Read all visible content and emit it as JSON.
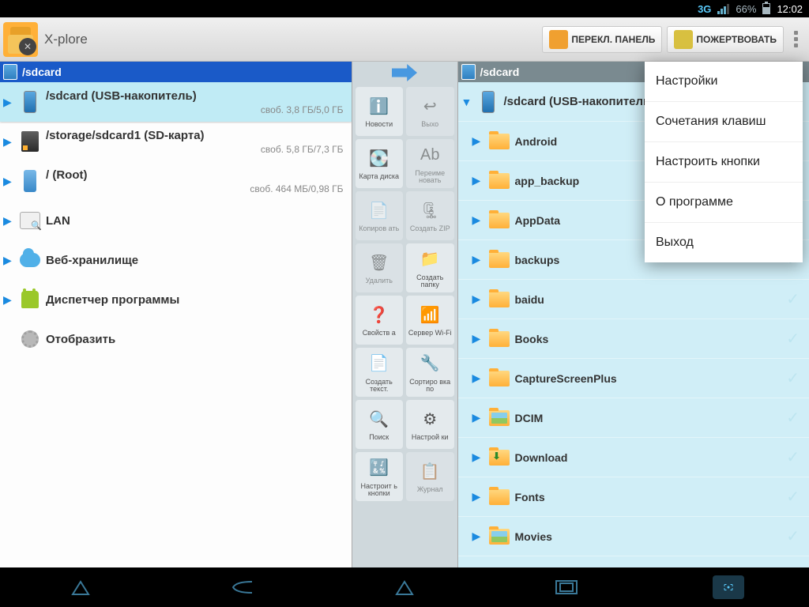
{
  "statusbar": {
    "net": "3G",
    "battery": "66%",
    "time": "12:02"
  },
  "toolbar": {
    "title": "X-plore",
    "switch_panel": "ПЕРЕКЛ. ПАНЕЛЬ",
    "donate": "ПОЖЕРТВОВАТЬ"
  },
  "left": {
    "head": "/sdcard",
    "items": [
      {
        "name": "/sdcard (USB-накопитель)",
        "sub": "своб. 3,8 ГБ/5,0 ГБ",
        "icon": "phone",
        "sel": true,
        "arrow": "▶"
      },
      {
        "name": "/storage/sdcard1 (SD-карта)",
        "sub": "своб. 5,8 ГБ/7,3 ГБ",
        "icon": "sdc",
        "arrow": "▶"
      },
      {
        "name": "/ (Root)",
        "sub": "своб. 464 МБ/0,98 ГБ",
        "icon": "root",
        "arrow": "▶"
      },
      {
        "name": "LAN",
        "icon": "lan",
        "arrow": "▶"
      },
      {
        "name": "Веб-хранилище",
        "icon": "cloud",
        "arrow": "▶"
      },
      {
        "name": "Диспетчер программы",
        "icon": "android",
        "arrow": "▶"
      },
      {
        "name": "Отобразить",
        "icon": "gear",
        "arrow": ""
      }
    ]
  },
  "right": {
    "head": "/sdcard",
    "parent": {
      "name": "/sdcard (USB-накопитель)",
      "icon": "phone",
      "arrow": "▼"
    },
    "folders": [
      {
        "name": "Android"
      },
      {
        "name": "app_backup"
      },
      {
        "name": "AppData"
      },
      {
        "name": "backups"
      },
      {
        "name": "baidu"
      },
      {
        "name": "Books"
      },
      {
        "name": "CaptureScreenPlus"
      },
      {
        "name": "DCIM",
        "pic": true
      },
      {
        "name": "Download",
        "dl": true
      },
      {
        "name": "Fonts"
      },
      {
        "name": "Movies",
        "pic": true
      }
    ]
  },
  "ops": [
    {
      "label": "Новости",
      "emoji": "ℹ️",
      "faded": false
    },
    {
      "label": "Выхо",
      "emoji": "↩",
      "faded": true
    },
    {
      "label": "Карта диска",
      "emoji": "💽",
      "faded": false
    },
    {
      "label": "Переиме новать",
      "emoji": "Ab",
      "faded": true
    },
    {
      "label": "Копиров ать",
      "emoji": "📄",
      "faded": true
    },
    {
      "label": "Создать ZIP",
      "emoji": "🗜",
      "faded": true
    },
    {
      "label": "Удалить",
      "emoji": "🗑",
      "faded": true
    },
    {
      "label": "Создать папку",
      "emoji": "📁",
      "faded": false
    },
    {
      "label": "Свойств а",
      "emoji": "❓",
      "faded": false
    },
    {
      "label": "Сервер Wi-Fi",
      "emoji": "📶",
      "faded": false
    },
    {
      "label": "Создать текст.",
      "emoji": "📄",
      "faded": false
    },
    {
      "label": "Сортиро вка по",
      "emoji": "🔧",
      "faded": false
    },
    {
      "label": "Поиск",
      "emoji": "🔍",
      "faded": false
    },
    {
      "label": "Настрой ки",
      "emoji": "⚙",
      "faded": false
    },
    {
      "label": "Настроит ь кнопки",
      "emoji": "🔣",
      "faded": false
    },
    {
      "label": "Журнал",
      "emoji": "📋",
      "faded": true
    }
  ],
  "menu": [
    "Настройки",
    "Сочетания клавиш",
    "Настроить кнопки",
    "О программе",
    "Выход"
  ]
}
